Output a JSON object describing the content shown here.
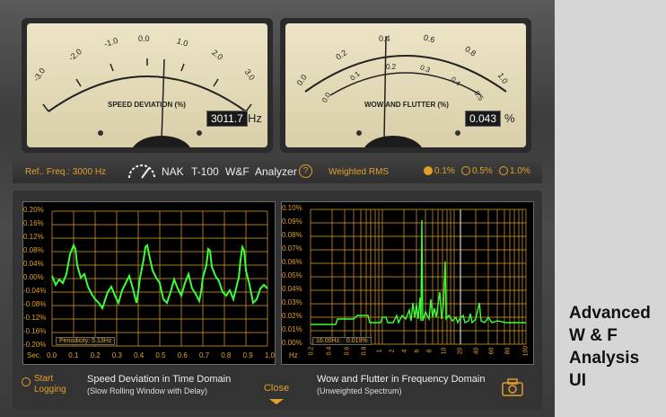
{
  "left_meter": {
    "scale_labels": [
      "-3.0",
      "-2.0",
      "-1.0",
      "0.0",
      "1.0",
      "2.0",
      "3.0"
    ],
    "title": "SPEED DEVIATION (%)",
    "value": "3011.7",
    "unit": "Hz"
  },
  "right_meter": {
    "scale_top": [
      "0.0",
      "0.2",
      "0.4",
      "0.6",
      "0.8",
      "1.0"
    ],
    "scale_inner": [
      "0.0",
      "0.1",
      "0.2",
      "0.3",
      "0.4",
      "0.5"
    ],
    "title": "WOW AND FLUTTER (%)",
    "value": "0.043",
    "unit": "%"
  },
  "control_bar": {
    "ref_freq": "Ref.. Freq.: 3000 Hz",
    "brand": "NAK",
    "model": "T-100",
    "wf": "W&F",
    "analyzer": "Analyzer",
    "help": "?",
    "weighting": "Weighted RMS",
    "ranges": [
      "0.1%",
      "0.5%",
      "1.0%"
    ],
    "selected_range": "0.1%"
  },
  "left_scope": {
    "y_ticks": [
      "0.20%",
      "0.16%",
      "0.12%",
      "0.08%",
      "0.04%",
      "0.00%",
      "-0.04%",
      "-0.08%",
      "-0.12%",
      "-0.16%",
      "-0.20%"
    ],
    "x_unit": "Sec.",
    "x_ticks": [
      "0.0",
      "0.1",
      "0.2",
      "0.3",
      "0.4",
      "0.5",
      "0.6",
      "0.7",
      "0.8",
      "0.9",
      "1.0"
    ],
    "readout": "Periodicity: 5.13Hz",
    "title": "Speed Deviation in Time Domain",
    "subtitle": "(Slow Rolling Window with Delay)"
  },
  "right_scope": {
    "y_ticks": [
      "0.10%",
      "0.09%",
      "0.08%",
      "0.07%",
      "0.06%",
      "0.05%",
      "0.04%",
      "0.03%",
      "0.02%",
      "0.01%",
      "0.00%"
    ],
    "x_unit": "Hz",
    "x_ticks": [
      "0.2",
      "0.4",
      "0.6",
      "0.8",
      "1",
      "2",
      "4",
      "6",
      "8",
      "10",
      "20",
      "40",
      "60",
      "80",
      "100"
    ],
    "readout_freq": "16.00Hz.",
    "readout_val": "0.019%",
    "title": "Wow and Flutter in Frequency Domain",
    "subtitle": "(Unweighted Spectrum)"
  },
  "bottom": {
    "start_line1": "Start",
    "start_line2": "Logging",
    "close": "Close"
  },
  "caption": {
    "line1": "Advanced",
    "line2": "W & F",
    "line3": "Analysis",
    "line4": "UI"
  },
  "colors": {
    "accent": "#e0a02a",
    "trace": "#39ff3a",
    "face": "#e6ddbb"
  }
}
